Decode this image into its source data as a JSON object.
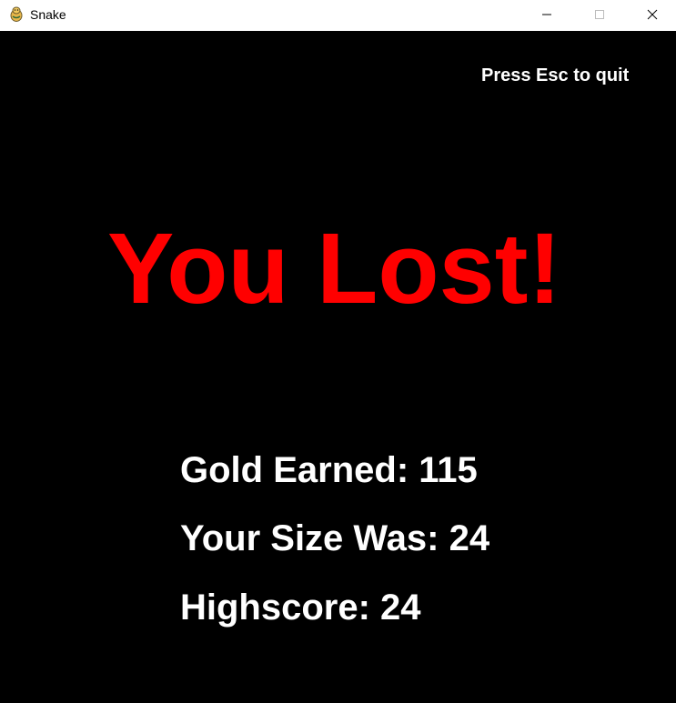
{
  "window": {
    "title": "Snake",
    "icon": "pygame-snake-icon",
    "controls": {
      "minimize": "minimize-icon",
      "maximize": "maximize-icon",
      "close": "close-icon"
    }
  },
  "game": {
    "background": "#000000",
    "hint": "Press Esc to quit",
    "headline": "You Lost!",
    "headline_color": "#ff0000",
    "stats": {
      "gold": "Gold Earned: 115",
      "size": "Your Size Was: 24",
      "highscore": "Highscore: 24"
    }
  }
}
